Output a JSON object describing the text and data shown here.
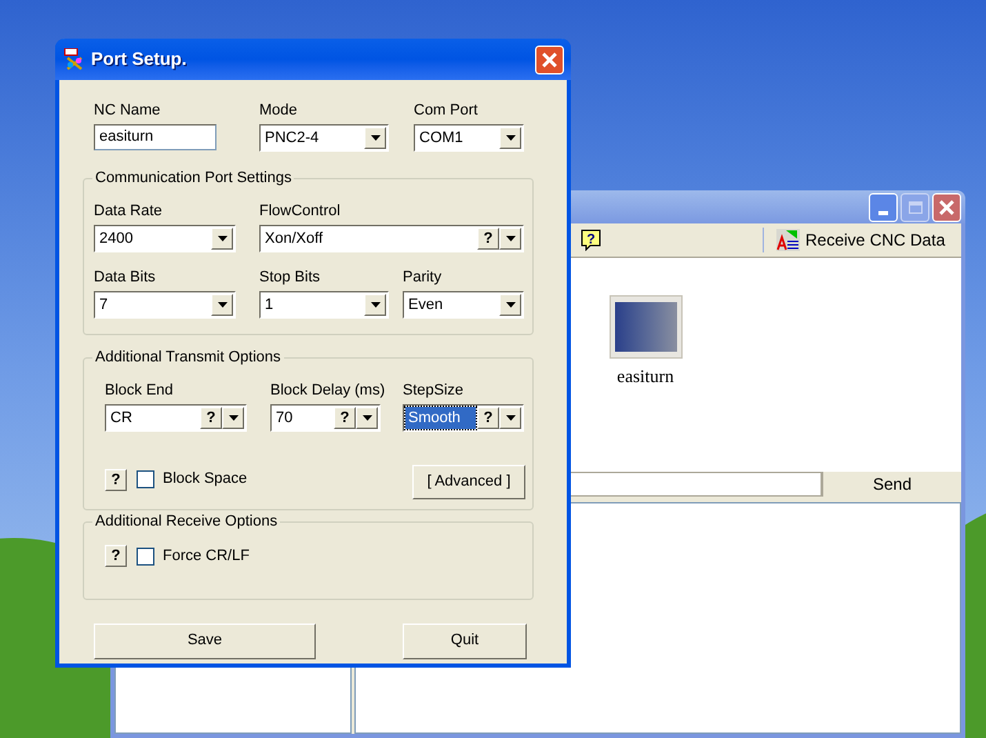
{
  "back_window": {
    "help_button": "?",
    "toolbar_label": "Receive CNC Data",
    "machines": [
      {
        "label": "easiturn"
      }
    ],
    "send_button": "Send"
  },
  "dialog": {
    "title": "Port Setup.",
    "top_fields": [
      {
        "label": "NC Name",
        "kind": "text",
        "value": "easiturn",
        "focused": false
      },
      {
        "label": "Mode",
        "kind": "combo",
        "value": "PNC2-4",
        "focused": false
      },
      {
        "label": "Com Port",
        "kind": "combo",
        "value": "COM1",
        "focused": false
      }
    ],
    "groups": [
      {
        "title": "Communication Port Settings",
        "rows": [
          [
            {
              "label": "Data Rate",
              "kind": "combo",
              "value": "2400",
              "focused": false
            },
            {
              "label": "FlowControl",
              "kind": "help_combo",
              "value": "Xon/Xoff",
              "help": "?",
              "focused": false
            }
          ],
          [
            {
              "label": "Data Bits",
              "kind": "combo",
              "value": "7",
              "focused": false
            },
            {
              "label": "Stop Bits",
              "kind": "combo",
              "value": "1",
              "focused": false
            },
            {
              "label": "Parity",
              "kind": "combo",
              "value": "Even",
              "focused": false
            }
          ]
        ]
      },
      {
        "title": "Additional Transmit Options",
        "rows": [
          [
            {
              "label": "Block End",
              "kind": "help_combo",
              "value": "CR",
              "help": "?",
              "focused": false
            },
            {
              "label": "Block Delay (ms)",
              "kind": "help_combo",
              "value": "70",
              "help": "?",
              "focused": false
            },
            {
              "label": "StepSize",
              "kind": "help_combo",
              "value": "Smooth",
              "help": "?",
              "focused": true
            }
          ]
        ],
        "options": [
          {
            "help": "?",
            "label": "Block Space",
            "checked": false
          }
        ],
        "button": "[ Advanced ]"
      },
      {
        "title": "Additional Receive Options",
        "options": [
          {
            "help": "?",
            "label": "Force CR/LF",
            "checked": false
          }
        ]
      }
    ],
    "buttons": [
      "Save",
      "Quit"
    ]
  }
}
